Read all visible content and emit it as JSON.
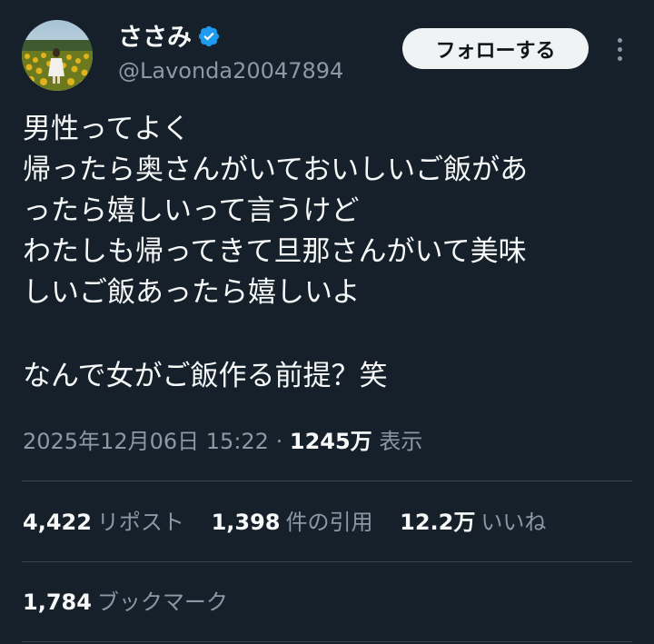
{
  "author": {
    "display_name": "ささみ",
    "handle": "@Lavonda20047894",
    "verified": true,
    "avatar_icon": "profile-photo-sunflower-field"
  },
  "actions": {
    "follow_label": "フォローする",
    "more_icon": "more-options-icon"
  },
  "tweet": {
    "lines": [
      "男性ってよく",
      "帰ったら奥さんがいておいしいご飯があ",
      "ったら嬉しいって言うけど",
      "わたしも帰ってきて旦那さんがいて美味",
      "しいご飯あったら嬉しいよ",
      "",
      "なんで女がご飯作る前提？笑"
    ]
  },
  "meta": {
    "datetime": "2025年12月06日 15:22",
    "separator": "·",
    "views_count": "1245万",
    "views_label": "表示"
  },
  "stats": {
    "reposts": {
      "count": "4,422",
      "label": "リポスト"
    },
    "quotes": {
      "count": "1,398",
      "label": "件の引用"
    },
    "likes": {
      "count": "12.2万",
      "label": "いいね"
    },
    "bookmarks": {
      "count": "1,784",
      "label": "ブックマーク"
    }
  },
  "colors": {
    "background": "#15202b",
    "text_primary": "#f7f9f9",
    "text_secondary": "#8b98a5",
    "divider": "#38444d",
    "verified_blue": "#1d9bf0",
    "follow_button_bg": "#eff3f4"
  }
}
